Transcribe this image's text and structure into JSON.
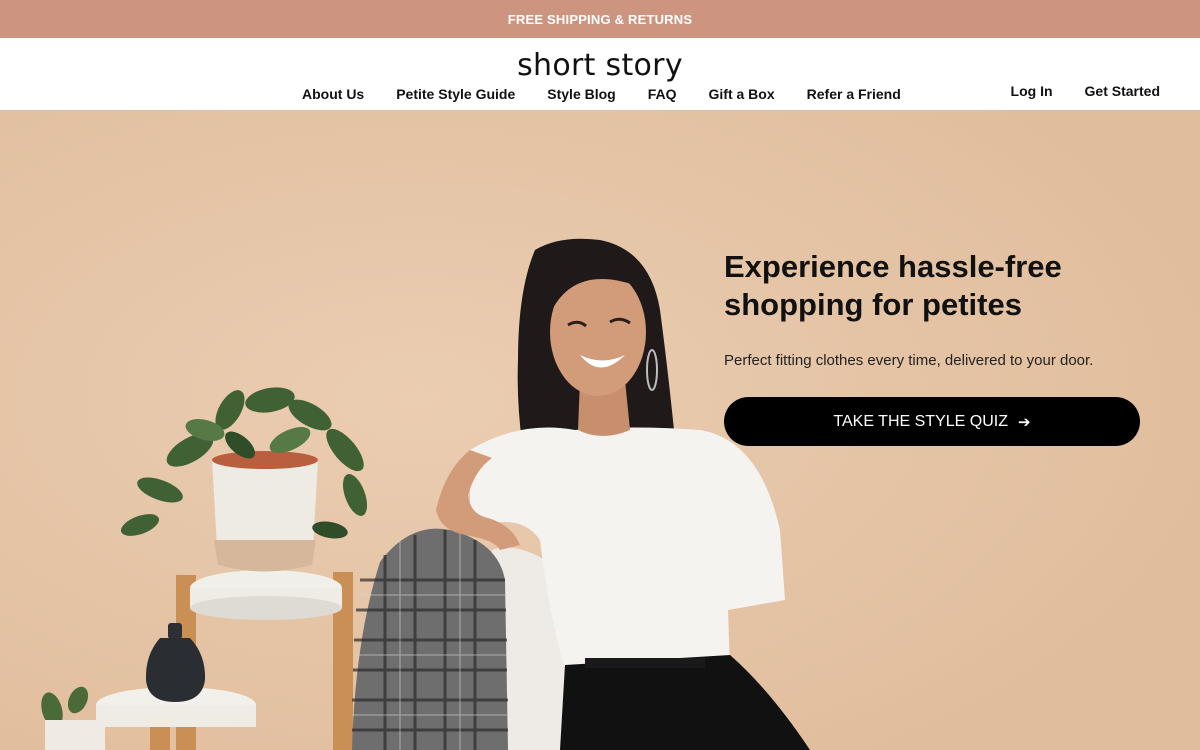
{
  "promo": {
    "text": "FREE SHIPPING & RETURNS"
  },
  "header": {
    "logo": "short story",
    "nav": [
      {
        "label": "About Us"
      },
      {
        "label": "Petite Style Guide"
      },
      {
        "label": "Style Blog"
      },
      {
        "label": "FAQ"
      },
      {
        "label": "Gift a Box"
      },
      {
        "label": "Refer a Friend"
      }
    ],
    "account": {
      "login": "Log In",
      "get_started": "Get Started"
    }
  },
  "hero": {
    "title_line1": "Experience hassle-free",
    "title_line2": "shopping for petites",
    "subtitle": "Perfect fitting clothes every time, delivered to your door.",
    "cta_label": "TAKE THE STYLE QUIZ",
    "cta_icon": "arrow-right-icon"
  },
  "colors": {
    "promo_bg": "#cd9580",
    "hero_bg": "#e6c3a5",
    "cta_bg": "#000000"
  }
}
